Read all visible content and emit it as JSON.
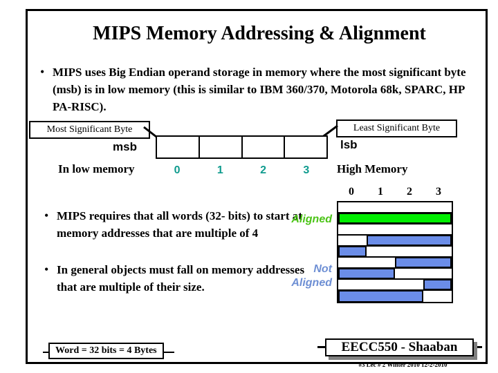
{
  "slide": {
    "title": "MIPS Memory Addressing & Alignment",
    "bullet_marker": "•"
  },
  "bullets": {
    "first": "MIPS uses Big Endian operand storage in memory where the most significant byte (msb) is in low memory (this is similar to IBM 360/370, Motorola 68k, SPARC, HP PA-RISC).",
    "second": "MIPS requires that all words (32-  bits) to start at memory addresses that are multiple of 4",
    "third": "In general objects must fall on memory addresses that are multiple of their size."
  },
  "endian_diagram": {
    "msb_callout": "Most Significant Byte",
    "msb_tag": "msb",
    "lsb_callout": "Least Significant Byte",
    "lsb_tag": "lsb",
    "low_memory_label": "In low memory",
    "high_memory_label": "High Memory",
    "byte_numbers": [
      "0",
      "1",
      "2",
      "3"
    ],
    "byte_number_color": "#0F9B8E",
    "cell_count": 4
  },
  "alignment_diagram": {
    "column_numbers": [
      "0",
      "1",
      "2",
      "3"
    ],
    "aligned_label": "Aligned",
    "aligned_color": "#4CC417",
    "not_aligned_label": "Not\nAligned",
    "not_aligned_color": "#6E8FD4",
    "aligned_fill_color": "#00EE00",
    "unaligned_fill_color": "#6B8DE8",
    "rows": [
      {
        "fill": "none",
        "start": 0,
        "end": 0,
        "color": ""
      },
      {
        "fill": "aligned",
        "start": 0,
        "end": 4,
        "color": "#00EE00"
      },
      {
        "fill": "none",
        "start": 0,
        "end": 0,
        "color": ""
      },
      {
        "fill": "unaligned",
        "start": 1,
        "end": 4,
        "color": "#6B8DE8"
      },
      {
        "fill": "unaligned",
        "start": 0,
        "end": 1,
        "color": "#6B8DE8"
      },
      {
        "fill": "unaligned",
        "start": 2,
        "end": 4,
        "color": "#6B8DE8"
      },
      {
        "fill": "unaligned",
        "start": 0,
        "end": 2,
        "color": "#6B8DE8"
      },
      {
        "fill": "unaligned",
        "start": 3,
        "end": 4,
        "color": "#6B8DE8"
      },
      {
        "fill": "unaligned",
        "start": 0,
        "end": 3,
        "color": "#6B8DE8"
      }
    ]
  },
  "footer": {
    "word_note": "Word = 32 bits = 4 Bytes",
    "course": "EECC550 - Shaaban",
    "sub": "#3   Lec # 2   Winter 2010  12-2-2010"
  }
}
